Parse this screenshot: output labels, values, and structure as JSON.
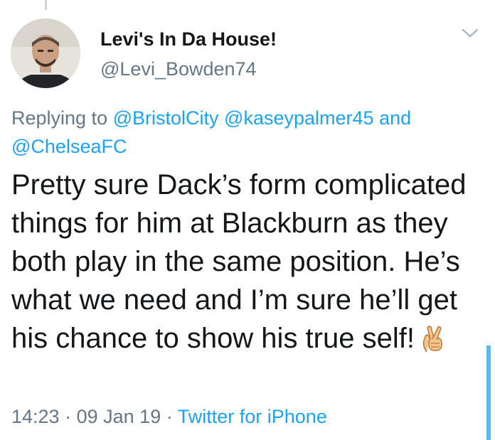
{
  "tweet": {
    "display_name": "Levi's In Da House!",
    "handle": "@Levi_Bowden74",
    "replying_prefix": "Replying to",
    "replying_mentions": [
      "@BristolCity",
      "@kaseypalmer45"
    ],
    "replying_and": "and",
    "replying_last_mention": "@ChelseaFC",
    "text": "Pretty sure Dack’s form complicated things for him at Blackburn as they both play in the same position. He’s what we need and I’m sure he’ll get his chance to show his true self!",
    "emoji": "crossed-fingers-emoji",
    "time": "14:23",
    "separator": "·",
    "date": "09 Jan 19",
    "source": "Twitter for iPhone"
  },
  "colors": {
    "text": "#14171a",
    "secondary": "#657786",
    "accent": "#1da1f2"
  },
  "icons": {
    "menu": "chevron-down-icon",
    "thread": "thread-line"
  }
}
